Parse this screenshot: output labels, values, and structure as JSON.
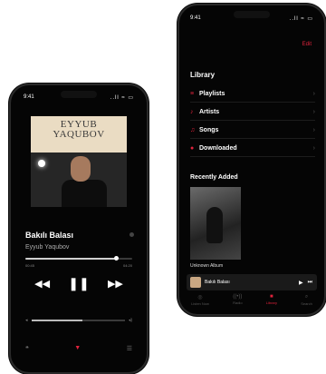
{
  "library_phone": {
    "status_time": "9:41",
    "status_icons": "..ll ≈ ▭",
    "edit_label": "Edit",
    "library_title": "Library",
    "rows": [
      {
        "icon": "playlist-icon",
        "label": "Playlists"
      },
      {
        "icon": "artist-icon",
        "label": "Artists"
      },
      {
        "icon": "music-note-icon",
        "label": "Songs"
      },
      {
        "icon": "download-icon",
        "label": "Downloaded"
      }
    ],
    "recently_added_title": "Recently Added",
    "album_name": "Unknown Album",
    "mini_player_title": "Bakılı Balası",
    "tabs": [
      {
        "label": "Listen Now",
        "icon": "play-circle-icon",
        "active": false
      },
      {
        "label": "Radio",
        "icon": "radio-icon",
        "active": false
      },
      {
        "label": "Library",
        "icon": "library-icon",
        "active": true
      },
      {
        "label": "Search",
        "icon": "search-icon",
        "active": false
      }
    ]
  },
  "player_phone": {
    "status_time": "9:41",
    "status_icons": "..ll ≈ ▭",
    "cover_title_line1": "EYYUB",
    "cover_title_line2": "YAQUBOV",
    "song_title": "Bakılı Balası",
    "song_artist": "Eyyub Yaqubov",
    "time_elapsed": "00:45",
    "time_total": "04:20",
    "progress_fraction": 0.85,
    "volume_fraction": 0.55
  },
  "accent_color": "#e0223c"
}
